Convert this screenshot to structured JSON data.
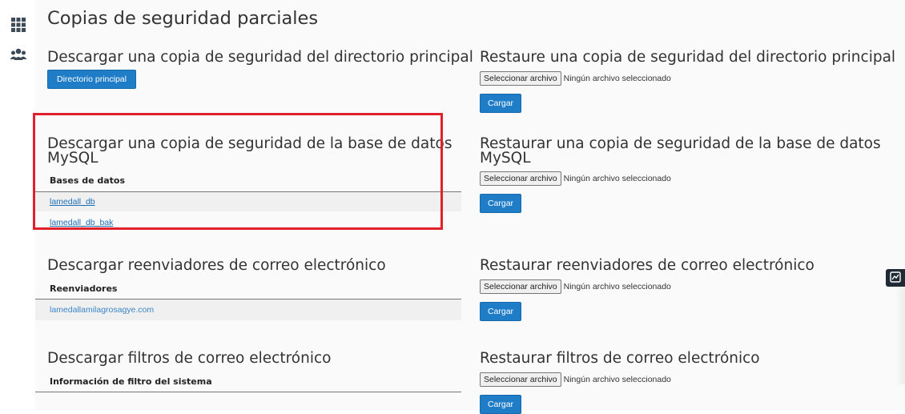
{
  "page": {
    "title": "Copias de seguridad parciales"
  },
  "sidebar": {
    "icons": [
      "apps-grid-icon",
      "users-icon"
    ]
  },
  "sections": {
    "home": {
      "download_title": "Descargar una copia de seguridad del directorio principal",
      "download_button": "Directorio principal",
      "restore_title": "Restaure una copia de seguridad del directorio principal",
      "choose_file": "Seleccionar archivo",
      "no_file": "Ningún archivo seleccionado",
      "upload_button": "Cargar"
    },
    "mysql": {
      "download_title_line1": "Descargar una copia de seguridad de la base de datos",
      "download_title_line2": "MySQL",
      "table_header": "Bases de datos",
      "databases": [
        "lamedall_db",
        "lamedall_db_bak"
      ],
      "restore_title_line1": "Restaurar una copia de seguridad de la base de datos",
      "restore_title_line2": "MySQL",
      "choose_file": "Seleccionar archivo",
      "no_file": "Ningún archivo seleccionado",
      "upload_button": "Cargar"
    },
    "forwarders": {
      "download_title": "Descargar reenviadores de correo electrónico",
      "table_header": "Reenviadores",
      "items": [
        "lamedallamilagrosagye.com"
      ],
      "restore_title": "Restaurar reenviadores de correo electrónico",
      "choose_file": "Seleccionar archivo",
      "no_file": "Ningún archivo seleccionado",
      "upload_button": "Cargar"
    },
    "filters": {
      "download_title": "Descargar filtros de correo electrónico",
      "table_header": "Información de filtro del sistema",
      "restore_title": "Restaurar filtros de correo electrónico",
      "choose_file": "Seleccionar archivo",
      "no_file": "Ningún archivo seleccionado",
      "upload_button": "Cargar"
    }
  },
  "colors": {
    "button_blue": "#1f7dc7",
    "highlight_red": "#e0202a",
    "link_blue": "#1f6fb5"
  }
}
